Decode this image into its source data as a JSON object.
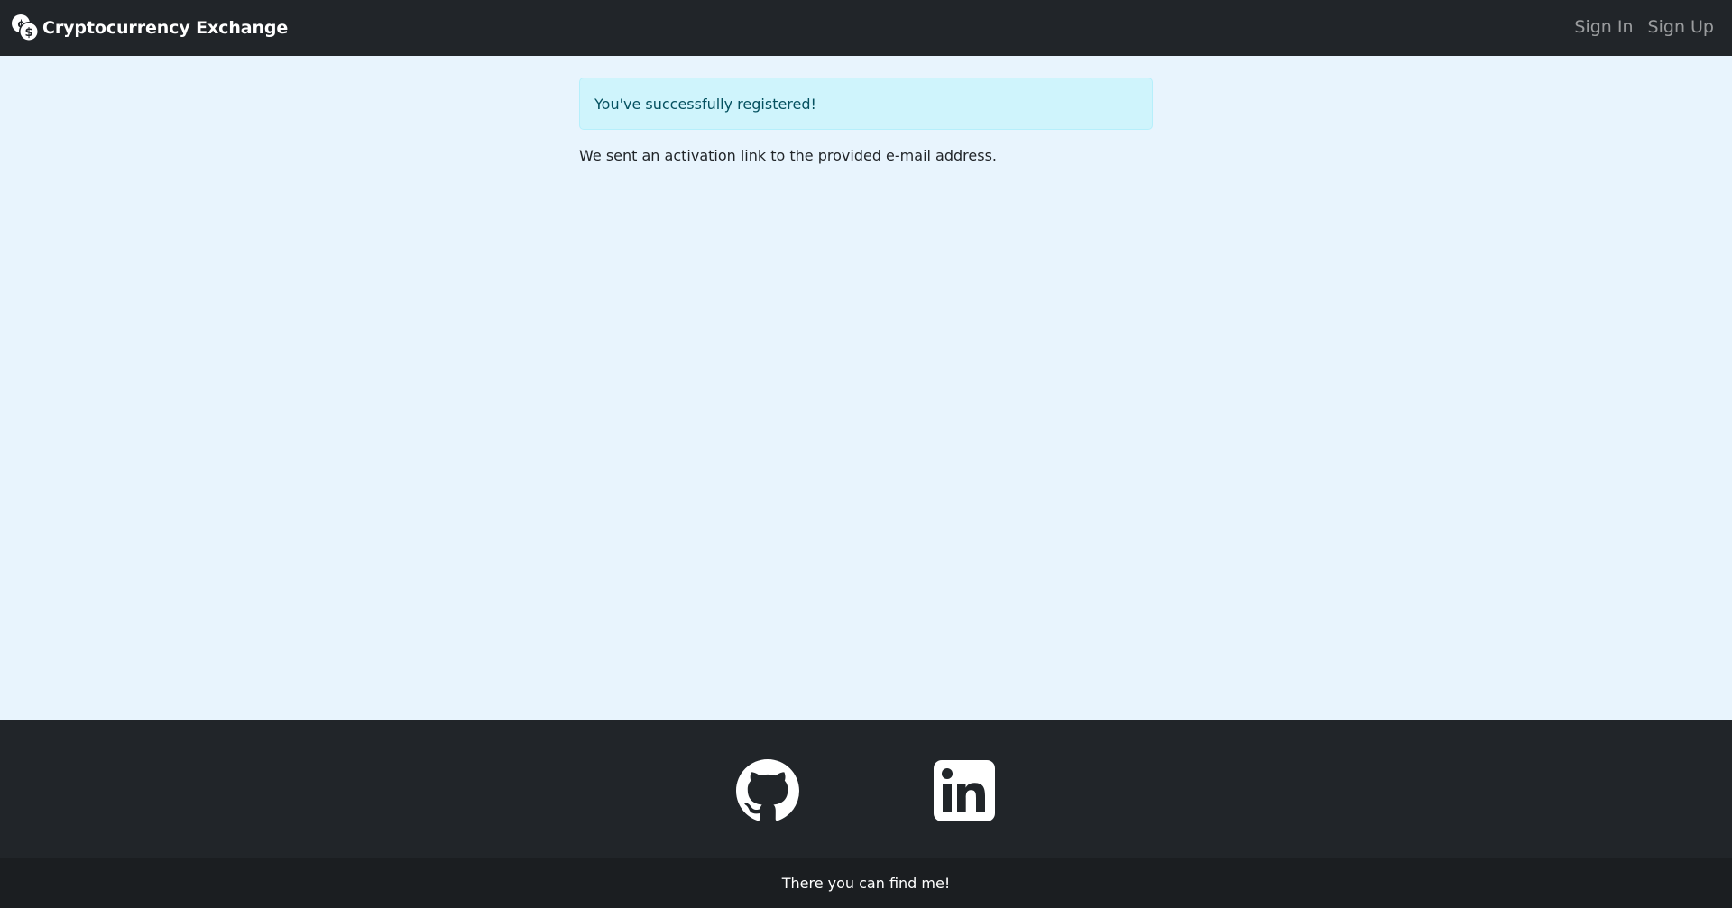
{
  "navbar": {
    "brand": {
      "icon": "coins-icon",
      "title": "Cryptocurrency Exchange"
    },
    "links": [
      {
        "label": "Sign In"
      },
      {
        "label": "Sign Up"
      }
    ]
  },
  "main": {
    "alert": {
      "text": "You've successfully registered!"
    },
    "message": "We sent an activation link to the provided e-mail address."
  },
  "footer": {
    "social": [
      {
        "icon": "github-icon"
      },
      {
        "icon": "linkedin-icon"
      }
    ],
    "caption": "There you can find me!"
  },
  "colors": {
    "navbar_bg": "#212529",
    "page_bg": "#e8f4fd",
    "alert_bg": "#cff4fc",
    "alert_text": "#055160",
    "footer_bg": "#212529",
    "copyright_bg": "#1b1e21"
  }
}
